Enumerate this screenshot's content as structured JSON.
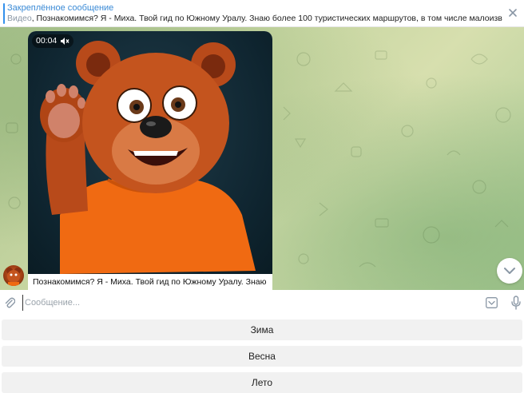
{
  "pinned": {
    "title": "Закреплённое сообщение",
    "kind": "Видео",
    "text": ", Познакомимся? Я - Миха. Твой гид по Южному Уралу. Знаю более 100 туристических маршрутов, в том числе малоизвестных и ..."
  },
  "message": {
    "duration": "00:04",
    "caption": "Познакомимся? Я - Миха. Твой гид по Южному Уралу. Знаю"
  },
  "composer": {
    "placeholder": "Сообщение..."
  },
  "keyboard": {
    "buttons": [
      "Зима",
      "Весна",
      "Лето"
    ]
  },
  "colors": {
    "accent": "#3390ec",
    "bear_fur": "#c4541e",
    "shirt": "#f06a12"
  }
}
